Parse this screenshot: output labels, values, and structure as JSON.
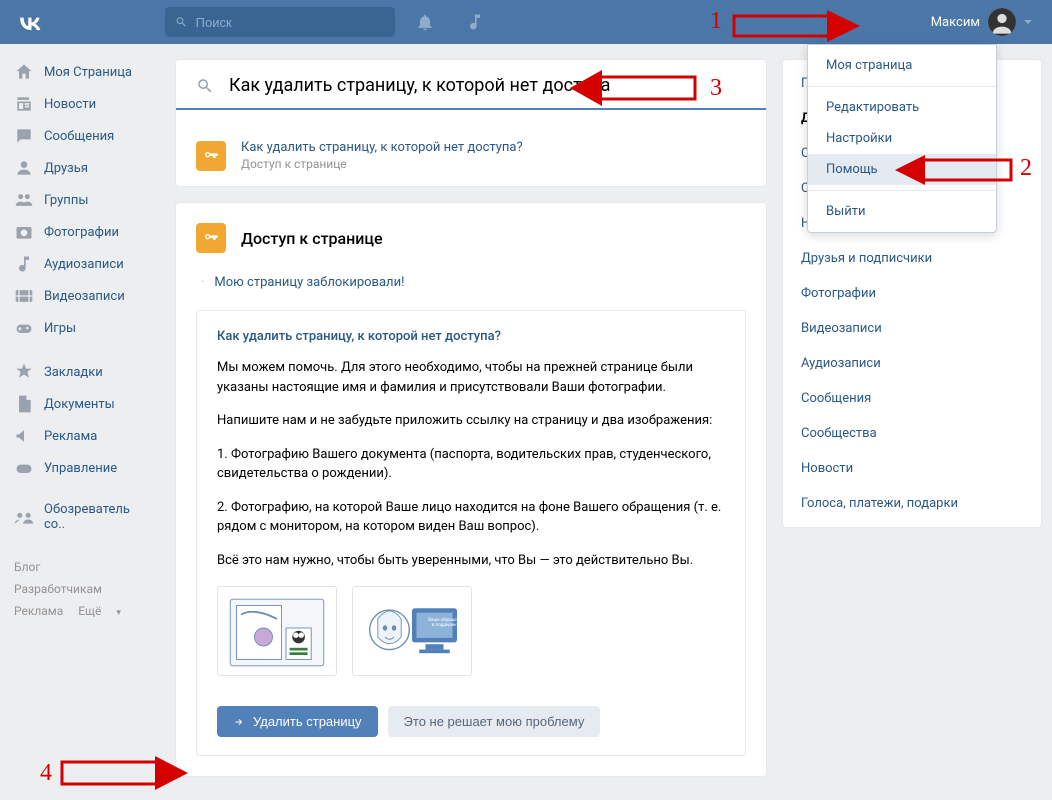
{
  "header": {
    "search_placeholder": "Поиск",
    "user_name": "Максим"
  },
  "nav": {
    "items": [
      {
        "label": "Моя Страница",
        "icon": "home"
      },
      {
        "label": "Новости",
        "icon": "news"
      },
      {
        "label": "Сообщения",
        "icon": "messages"
      },
      {
        "label": "Друзья",
        "icon": "friends"
      },
      {
        "label": "Группы",
        "icon": "groups"
      },
      {
        "label": "Фотографии",
        "icon": "photos"
      },
      {
        "label": "Аудиозаписи",
        "icon": "audio"
      },
      {
        "label": "Видеозаписи",
        "icon": "video"
      },
      {
        "label": "Игры",
        "icon": "games"
      }
    ],
    "items2": [
      {
        "label": "Закладки",
        "icon": "bookmark"
      },
      {
        "label": "Документы",
        "icon": "docs"
      },
      {
        "label": "Реклама",
        "icon": "ads"
      },
      {
        "label": "Управление",
        "icon": "manage"
      }
    ],
    "items3": [
      {
        "label": "Обозреватель со..",
        "icon": "browser"
      }
    ],
    "footer": {
      "blog": "Блог",
      "dev": "Разработчикам",
      "ads": "Реклама",
      "more": "Ещё"
    }
  },
  "search_page": {
    "query": "Как удалить страницу, к которой нет доступа",
    "suggestion_title": "Как удалить страницу, к которой нет доступа?",
    "suggestion_sub": "Доступ к странице"
  },
  "article": {
    "section_title": "Доступ к странице",
    "blocked_link": "Мою страницу заблокировали!",
    "question": "Как удалить страницу, к которой нет доступа?",
    "p1": "Мы можем помочь. Для этого необходимо, чтобы на прежней странице были указаны настоящие имя и фамилия и присутствовали Ваши фотографии.",
    "p2": "Напишите нам и не забудьте приложить ссылку на страницу и два изображения:",
    "p3": "1. Фотографию Вашего документа (паспорта, водительских прав, студенческого, свидетельства о рождении).",
    "p4": "2. Фотографию, на которой Ваше лицо находится на фоне Вашего обращения (т. е. рядом с монитором, на котором виден Ваш вопрос).",
    "p5": "Всё это нам нужно, чтобы быть уверенными, что Вы — это действительно Вы.",
    "btn_delete": "Удалить страницу",
    "btn_nope": "Это не решает мою проблему"
  },
  "categories": [
    {
      "label": "Популярные вопросы",
      "active": false
    },
    {
      "label": "Доступ к странице",
      "active": true
    },
    {
      "label": "Общие вопросы",
      "active": false
    },
    {
      "label": "Страница",
      "active": false
    },
    {
      "label": "Настройки приватности",
      "active": false
    },
    {
      "label": "Друзья и подписчики",
      "active": false
    },
    {
      "label": "Фотографии",
      "active": false
    },
    {
      "label": "Видеозаписи",
      "active": false
    },
    {
      "label": "Аудиозаписи",
      "active": false
    },
    {
      "label": "Сообщения",
      "active": false
    },
    {
      "label": "Сообщества",
      "active": false
    },
    {
      "label": "Новости",
      "active": false
    },
    {
      "label": "Голоса, платежи, подарки",
      "active": false
    }
  ],
  "dropdown": {
    "items": [
      "Моя страница",
      "Редактировать",
      "Настройки",
      "Помощь",
      "Выйти"
    ],
    "highlighted": "Помощь"
  },
  "annotations": {
    "n1": "1",
    "n2": "2",
    "n3": "3",
    "n4": "4"
  }
}
